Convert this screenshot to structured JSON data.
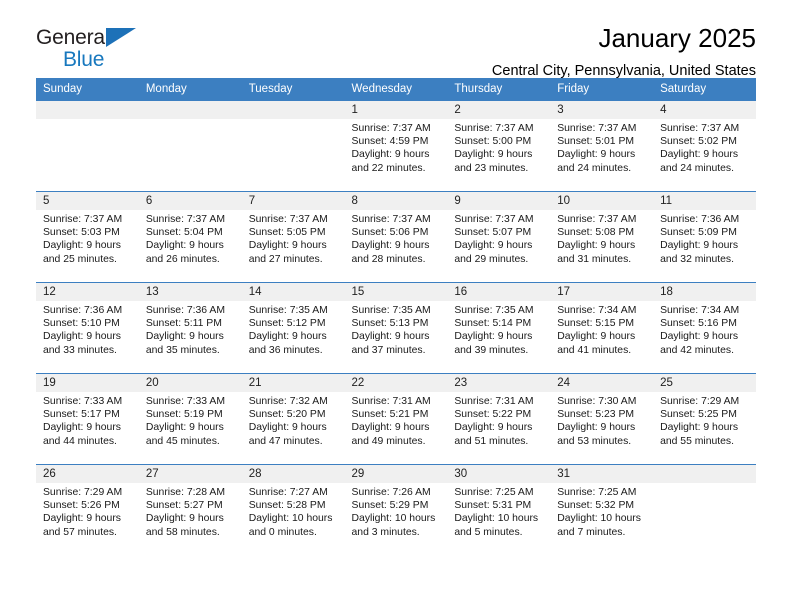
{
  "brand": {
    "name_part1": "General",
    "name_part2": "Blue",
    "triangle_color": "#1d71b8",
    "blue_color": "#1878be"
  },
  "header": {
    "title": "January 2025",
    "subtitle": "Central City, Pennsylvania, United States"
  },
  "theme": {
    "header_row_bg": "#3c7fc1",
    "daynum_bg": "#f0f0f0",
    "border_color": "#3c7fc1",
    "text_color": "#1a1a1a"
  },
  "weekdays": [
    "Sunday",
    "Monday",
    "Tuesday",
    "Wednesday",
    "Thursday",
    "Friday",
    "Saturday"
  ],
  "weeks": [
    [
      {
        "day": "",
        "sunrise": "",
        "sunset": "",
        "daylight_line1": "",
        "daylight_line2": ""
      },
      {
        "day": "",
        "sunrise": "",
        "sunset": "",
        "daylight_line1": "",
        "daylight_line2": ""
      },
      {
        "day": "",
        "sunrise": "",
        "sunset": "",
        "daylight_line1": "",
        "daylight_line2": ""
      },
      {
        "day": "1",
        "sunrise": "Sunrise: 7:37 AM",
        "sunset": "Sunset: 4:59 PM",
        "daylight_line1": "Daylight: 9 hours",
        "daylight_line2": "and 22 minutes."
      },
      {
        "day": "2",
        "sunrise": "Sunrise: 7:37 AM",
        "sunset": "Sunset: 5:00 PM",
        "daylight_line1": "Daylight: 9 hours",
        "daylight_line2": "and 23 minutes."
      },
      {
        "day": "3",
        "sunrise": "Sunrise: 7:37 AM",
        "sunset": "Sunset: 5:01 PM",
        "daylight_line1": "Daylight: 9 hours",
        "daylight_line2": "and 24 minutes."
      },
      {
        "day": "4",
        "sunrise": "Sunrise: 7:37 AM",
        "sunset": "Sunset: 5:02 PM",
        "daylight_line1": "Daylight: 9 hours",
        "daylight_line2": "and 24 minutes."
      }
    ],
    [
      {
        "day": "5",
        "sunrise": "Sunrise: 7:37 AM",
        "sunset": "Sunset: 5:03 PM",
        "daylight_line1": "Daylight: 9 hours",
        "daylight_line2": "and 25 minutes."
      },
      {
        "day": "6",
        "sunrise": "Sunrise: 7:37 AM",
        "sunset": "Sunset: 5:04 PM",
        "daylight_line1": "Daylight: 9 hours",
        "daylight_line2": "and 26 minutes."
      },
      {
        "day": "7",
        "sunrise": "Sunrise: 7:37 AM",
        "sunset": "Sunset: 5:05 PM",
        "daylight_line1": "Daylight: 9 hours",
        "daylight_line2": "and 27 minutes."
      },
      {
        "day": "8",
        "sunrise": "Sunrise: 7:37 AM",
        "sunset": "Sunset: 5:06 PM",
        "daylight_line1": "Daylight: 9 hours",
        "daylight_line2": "and 28 minutes."
      },
      {
        "day": "9",
        "sunrise": "Sunrise: 7:37 AM",
        "sunset": "Sunset: 5:07 PM",
        "daylight_line1": "Daylight: 9 hours",
        "daylight_line2": "and 29 minutes."
      },
      {
        "day": "10",
        "sunrise": "Sunrise: 7:37 AM",
        "sunset": "Sunset: 5:08 PM",
        "daylight_line1": "Daylight: 9 hours",
        "daylight_line2": "and 31 minutes."
      },
      {
        "day": "11",
        "sunrise": "Sunrise: 7:36 AM",
        "sunset": "Sunset: 5:09 PM",
        "daylight_line1": "Daylight: 9 hours",
        "daylight_line2": "and 32 minutes."
      }
    ],
    [
      {
        "day": "12",
        "sunrise": "Sunrise: 7:36 AM",
        "sunset": "Sunset: 5:10 PM",
        "daylight_line1": "Daylight: 9 hours",
        "daylight_line2": "and 33 minutes."
      },
      {
        "day": "13",
        "sunrise": "Sunrise: 7:36 AM",
        "sunset": "Sunset: 5:11 PM",
        "daylight_line1": "Daylight: 9 hours",
        "daylight_line2": "and 35 minutes."
      },
      {
        "day": "14",
        "sunrise": "Sunrise: 7:35 AM",
        "sunset": "Sunset: 5:12 PM",
        "daylight_line1": "Daylight: 9 hours",
        "daylight_line2": "and 36 minutes."
      },
      {
        "day": "15",
        "sunrise": "Sunrise: 7:35 AM",
        "sunset": "Sunset: 5:13 PM",
        "daylight_line1": "Daylight: 9 hours",
        "daylight_line2": "and 37 minutes."
      },
      {
        "day": "16",
        "sunrise": "Sunrise: 7:35 AM",
        "sunset": "Sunset: 5:14 PM",
        "daylight_line1": "Daylight: 9 hours",
        "daylight_line2": "and 39 minutes."
      },
      {
        "day": "17",
        "sunrise": "Sunrise: 7:34 AM",
        "sunset": "Sunset: 5:15 PM",
        "daylight_line1": "Daylight: 9 hours",
        "daylight_line2": "and 41 minutes."
      },
      {
        "day": "18",
        "sunrise": "Sunrise: 7:34 AM",
        "sunset": "Sunset: 5:16 PM",
        "daylight_line1": "Daylight: 9 hours",
        "daylight_line2": "and 42 minutes."
      }
    ],
    [
      {
        "day": "19",
        "sunrise": "Sunrise: 7:33 AM",
        "sunset": "Sunset: 5:17 PM",
        "daylight_line1": "Daylight: 9 hours",
        "daylight_line2": "and 44 minutes."
      },
      {
        "day": "20",
        "sunrise": "Sunrise: 7:33 AM",
        "sunset": "Sunset: 5:19 PM",
        "daylight_line1": "Daylight: 9 hours",
        "daylight_line2": "and 45 minutes."
      },
      {
        "day": "21",
        "sunrise": "Sunrise: 7:32 AM",
        "sunset": "Sunset: 5:20 PM",
        "daylight_line1": "Daylight: 9 hours",
        "daylight_line2": "and 47 minutes."
      },
      {
        "day": "22",
        "sunrise": "Sunrise: 7:31 AM",
        "sunset": "Sunset: 5:21 PM",
        "daylight_line1": "Daylight: 9 hours",
        "daylight_line2": "and 49 minutes."
      },
      {
        "day": "23",
        "sunrise": "Sunrise: 7:31 AM",
        "sunset": "Sunset: 5:22 PM",
        "daylight_line1": "Daylight: 9 hours",
        "daylight_line2": "and 51 minutes."
      },
      {
        "day": "24",
        "sunrise": "Sunrise: 7:30 AM",
        "sunset": "Sunset: 5:23 PM",
        "daylight_line1": "Daylight: 9 hours",
        "daylight_line2": "and 53 minutes."
      },
      {
        "day": "25",
        "sunrise": "Sunrise: 7:29 AM",
        "sunset": "Sunset: 5:25 PM",
        "daylight_line1": "Daylight: 9 hours",
        "daylight_line2": "and 55 minutes."
      }
    ],
    [
      {
        "day": "26",
        "sunrise": "Sunrise: 7:29 AM",
        "sunset": "Sunset: 5:26 PM",
        "daylight_line1": "Daylight: 9 hours",
        "daylight_line2": "and 57 minutes."
      },
      {
        "day": "27",
        "sunrise": "Sunrise: 7:28 AM",
        "sunset": "Sunset: 5:27 PM",
        "daylight_line1": "Daylight: 9 hours",
        "daylight_line2": "and 58 minutes."
      },
      {
        "day": "28",
        "sunrise": "Sunrise: 7:27 AM",
        "sunset": "Sunset: 5:28 PM",
        "daylight_line1": "Daylight: 10 hours",
        "daylight_line2": "and 0 minutes."
      },
      {
        "day": "29",
        "sunrise": "Sunrise: 7:26 AM",
        "sunset": "Sunset: 5:29 PM",
        "daylight_line1": "Daylight: 10 hours",
        "daylight_line2": "and 3 minutes."
      },
      {
        "day": "30",
        "sunrise": "Sunrise: 7:25 AM",
        "sunset": "Sunset: 5:31 PM",
        "daylight_line1": "Daylight: 10 hours",
        "daylight_line2": "and 5 minutes."
      },
      {
        "day": "31",
        "sunrise": "Sunrise: 7:25 AM",
        "sunset": "Sunset: 5:32 PM",
        "daylight_line1": "Daylight: 10 hours",
        "daylight_line2": "and 7 minutes."
      },
      {
        "day": "",
        "sunrise": "",
        "sunset": "",
        "daylight_line1": "",
        "daylight_line2": ""
      }
    ]
  ]
}
